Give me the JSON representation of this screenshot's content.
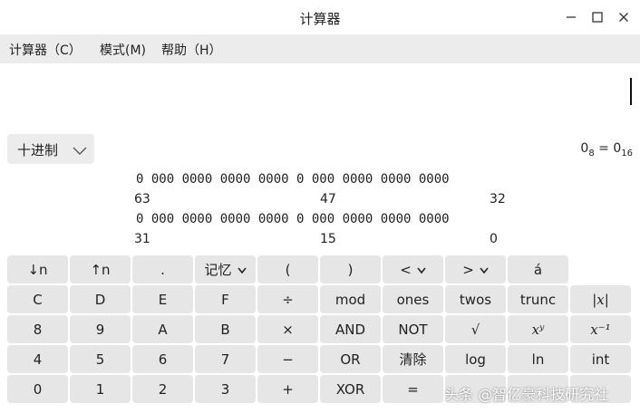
{
  "window": {
    "title": "计算器"
  },
  "menu": {
    "calculator": "计算器（C）",
    "mode": "模式(M)",
    "help": "帮助（H）"
  },
  "base_selector": {
    "value": "十进制"
  },
  "conversion": {
    "left": "0",
    "left_sub": "8",
    "eq": " = ",
    "right": "0",
    "right_sub": "16"
  },
  "bits": {
    "row1": "0 000 0000 0000 0000 0 000 0000 0000 0000",
    "row1_nums": [
      "63",
      "47",
      "32"
    ],
    "row2": "0 000 0000 0000 0000 0 000 0000 0000 0000",
    "row2_nums": [
      "31",
      "15",
      "0"
    ]
  },
  "keys": {
    "row0": [
      "↓n",
      "↑n",
      ".",
      "记忆",
      "(",
      ")",
      "<",
      ">",
      "á"
    ],
    "row1": [
      "C",
      "D",
      "E",
      "F",
      "÷",
      "mod",
      "ones",
      "twos",
      "trunc",
      "|x|"
    ],
    "row2": [
      "8",
      "9",
      "A",
      "B",
      "×",
      "AND",
      "NOT",
      "√",
      "xʸ",
      "x⁻¹"
    ],
    "row3": [
      "4",
      "5",
      "6",
      "7",
      "−",
      "OR",
      "清除",
      "log",
      "ln",
      "int"
    ],
    "row4": [
      "0",
      "1",
      "2",
      "3",
      "+",
      "XOR",
      "=",
      "",
      "",
      ""
    ]
  },
  "watermark": "头条 @智亿豪科技研究社"
}
